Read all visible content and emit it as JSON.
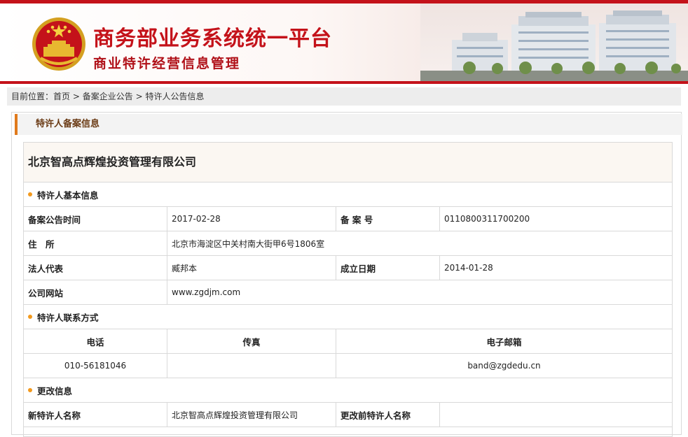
{
  "header": {
    "title_main": "商务部业务系统统一平台",
    "title_sub": "商业特许经营信息管理"
  },
  "breadcrumb": {
    "prefix": "目前位置：",
    "items": [
      "首页",
      "备案企业公告",
      "特许人公告信息"
    ],
    "separator": ">"
  },
  "panel": {
    "title": "特许人备案信息"
  },
  "company": {
    "name": "北京智高点辉煌投资管理有限公司"
  },
  "basic_info": {
    "section_title": "特许人基本信息",
    "filing_date_label": "备案公告时间",
    "filing_date": "2017-02-28",
    "filing_no_label": "备 案 号",
    "filing_no": "0110800311700200",
    "address_label": "住　所",
    "address": "北京市海淀区中关村南大街甲6号1806室",
    "legal_rep_label": "法人代表",
    "legal_rep": "臧邦本",
    "founded_label": "成立日期",
    "founded": "2014-01-28",
    "website_label": "公司网站",
    "website": "www.zgdjm.com"
  },
  "contact": {
    "section_title": "特许人联系方式",
    "headers": [
      "电话",
      "传真",
      "电子邮箱"
    ],
    "phone": "010-56181046",
    "fax": "",
    "email": "band@zgdedu.cn"
  },
  "changes": {
    "section_title": "更改信息",
    "new_name_label": "新特许人名称",
    "new_name": "北京智高点辉煌投资管理有限公司",
    "old_name_label": "更改前特许人名称",
    "old_name": ""
  },
  "colors": {
    "brand_red": "#c4121a",
    "accent_orange": "#e07a1c",
    "bullet_orange": "#f39a1e"
  }
}
